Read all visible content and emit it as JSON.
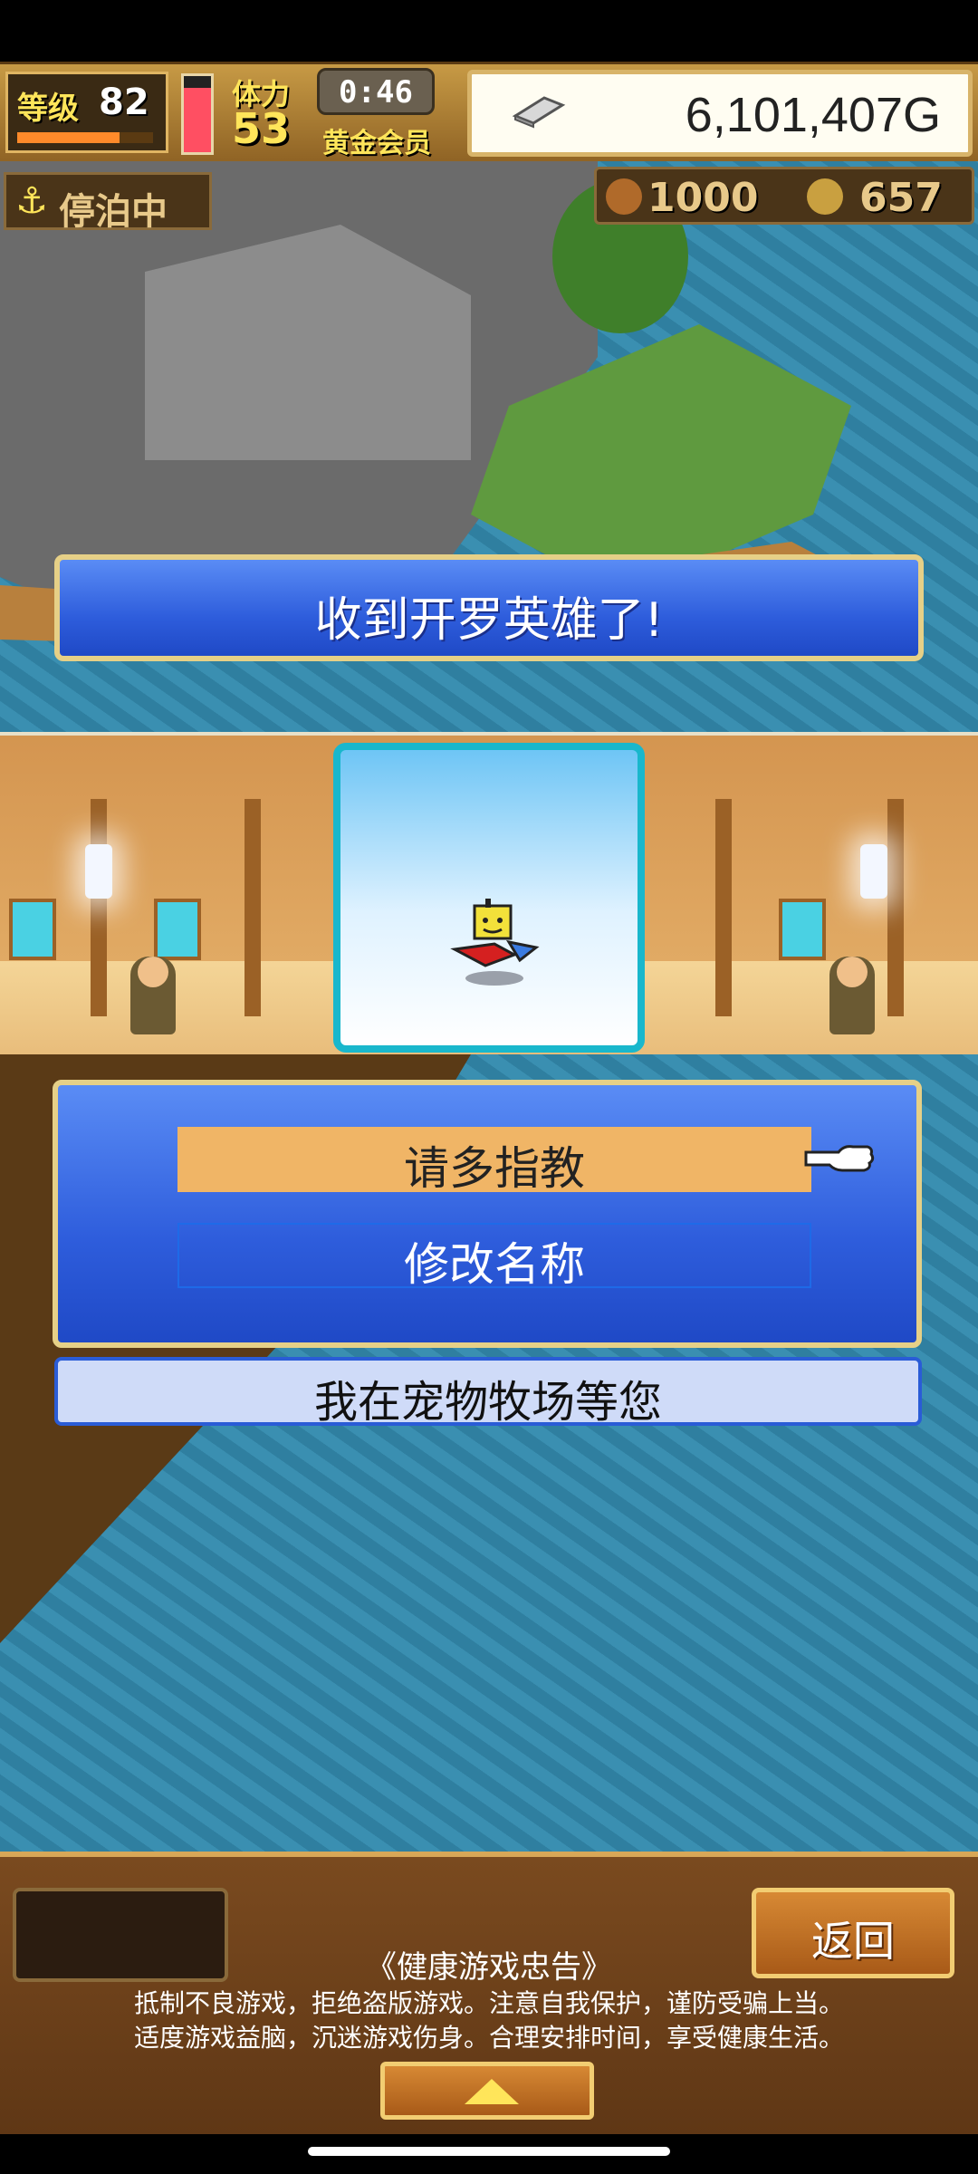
{
  "hud": {
    "level_label": "等级",
    "level_value": "82",
    "level_progress": 0.75,
    "stamina_label": "体力",
    "stamina_value": "53",
    "stamina_fill": 0.85,
    "timer": "0:46",
    "vip_label": "黄金会员",
    "gold": "6,101,407G"
  },
  "port": {
    "status": "停泊中",
    "resource1": "1000",
    "resource2": "657"
  },
  "banner": {
    "text": "收到开罗英雄了!"
  },
  "dialog": {
    "option1": "请多指教",
    "option2": "修改名称"
  },
  "caption": {
    "text": "我在宠物牧场等您"
  },
  "footer": {
    "back_label": "返回",
    "advisory_title": "《健康游戏忠告》",
    "advisory_line1": "抵制不良游戏，拒绝盗版游戏。注意自我保护，谨防受骗上当。",
    "advisory_line2": "适度游戏益脑，沉迷游戏伤身。合理安排时间，享受健康生活。"
  },
  "icons": {
    "level_bar": "level-progress-bar",
    "stamina": "stamina-gauge",
    "gold": "silver-bar-icon",
    "anchor": "anchor-icon",
    "resource1": "food-icon",
    "resource2": "coin-icon",
    "pointer": "pointing-hand-icon",
    "expand": "up-arrow-icon"
  },
  "colors": {
    "dialog_blue": "#2e5ddc",
    "highlight_option": "#f0b566",
    "frame_gold": "#e6d087"
  }
}
